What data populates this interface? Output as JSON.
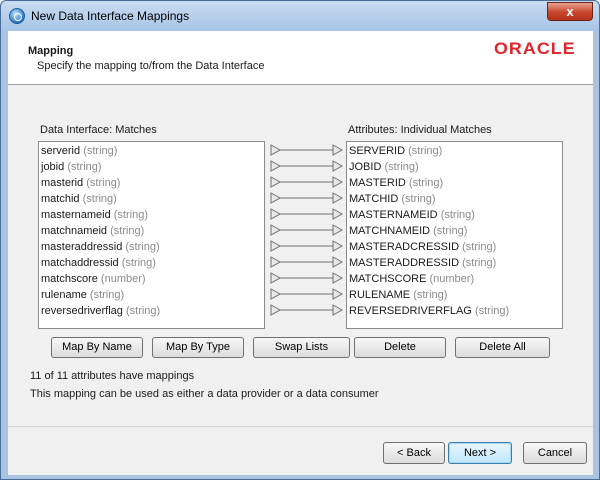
{
  "window": {
    "title": "New Data Interface Mappings",
    "close_label": "x"
  },
  "header": {
    "title": "Mapping",
    "subtitle": "Specify the mapping to/from the Data Interface",
    "logo_text": "ORACLE",
    "logo_color": "#e0262a"
  },
  "left_list": {
    "label": "Data Interface: Matches",
    "items": [
      {
        "name": "serverid",
        "type": "(string)"
      },
      {
        "name": "jobid",
        "type": "(string)"
      },
      {
        "name": "masterid",
        "type": "(string)"
      },
      {
        "name": "matchid",
        "type": "(string)"
      },
      {
        "name": "masternameid",
        "type": "(string)"
      },
      {
        "name": "matchnameid",
        "type": "(string)"
      },
      {
        "name": "masteraddressid",
        "type": "(string)"
      },
      {
        "name": "matchaddressid",
        "type": "(string)"
      },
      {
        "name": "matchscore",
        "type": "(number)"
      },
      {
        "name": "rulename",
        "type": "(string)"
      },
      {
        "name": "reversedriverflag",
        "type": "(string)"
      }
    ]
  },
  "right_list": {
    "label": "Attributes: Individual Matches",
    "items": [
      {
        "name": "SERVERID",
        "type": "(string)"
      },
      {
        "name": "JOBID",
        "type": "(string)"
      },
      {
        "name": "MASTERID",
        "type": "(string)"
      },
      {
        "name": "MATCHID",
        "type": "(string)"
      },
      {
        "name": "MASTERNAMEID",
        "type": "(string)"
      },
      {
        "name": "MATCHNAMEID",
        "type": "(string)"
      },
      {
        "name": "MASTERADCRESSID",
        "type": "(string)"
      },
      {
        "name": "MASTERADDRESSID",
        "type": "(string)"
      },
      {
        "name": "MATCHSCORE",
        "type": "(number)"
      },
      {
        "name": "RULENAME",
        "type": "(string)"
      },
      {
        "name": "REVERSEDRIVERFLAG",
        "type": "(string)"
      }
    ]
  },
  "actions": {
    "map_by_name": "Map By Name",
    "map_by_type": "Map By Type",
    "swap_lists": "Swap Lists",
    "delete": "Delete",
    "delete_all": "Delete All"
  },
  "status": {
    "mapping_count": "11 of 11 attributes have mappings",
    "usage_note": "This mapping can be used as either a data provider or a data consumer"
  },
  "footer": {
    "back": "< Back",
    "next": "Next >",
    "cancel": "Cancel"
  }
}
